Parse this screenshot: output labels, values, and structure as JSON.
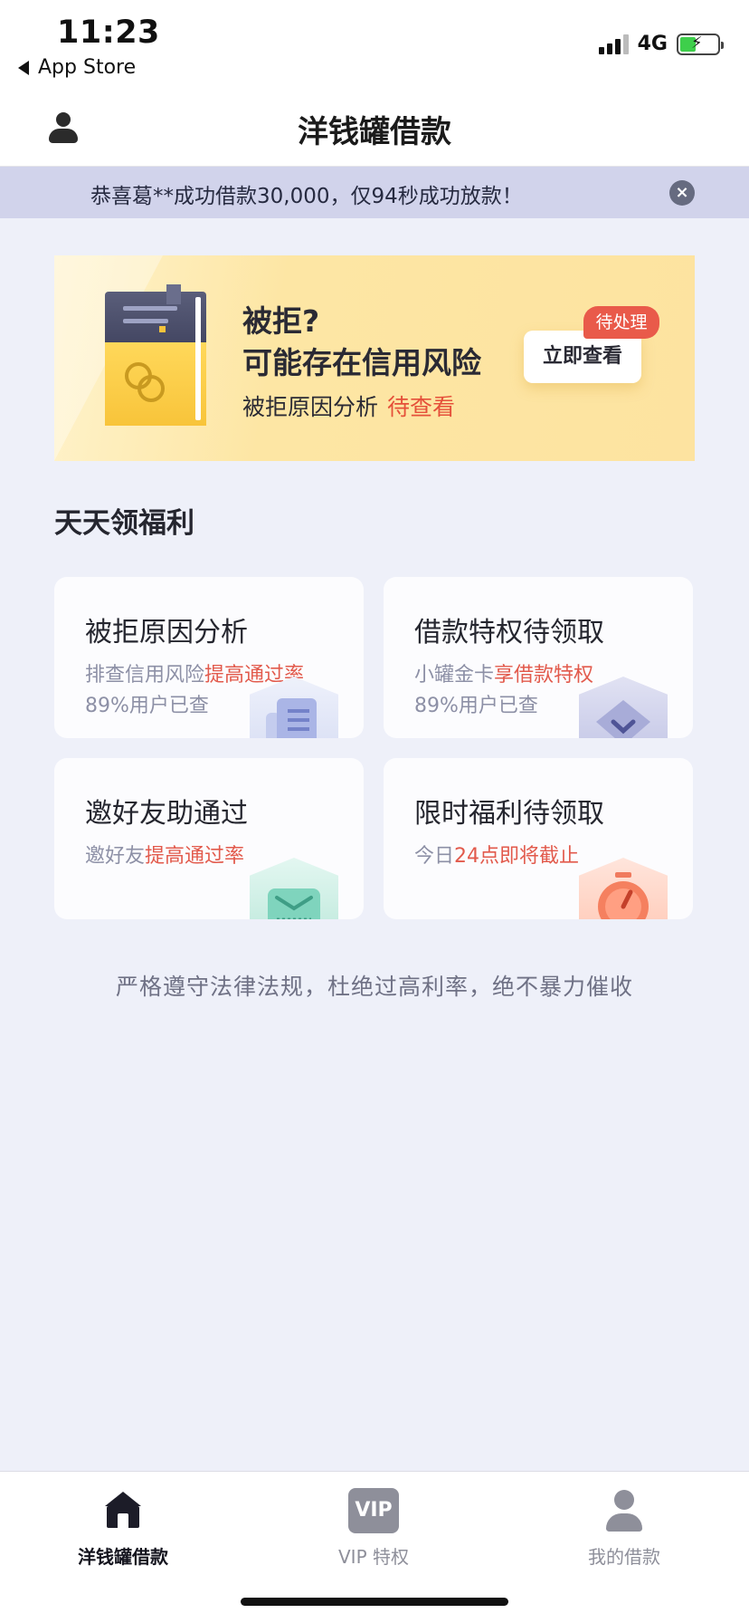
{
  "status_bar": {
    "time": "11:23",
    "back_label": "App Store",
    "network": "4G",
    "battery_level": 0.42,
    "battery_color": "#3ecf4b"
  },
  "nav": {
    "title": "洋钱罐借款",
    "left_icon": "user-icon"
  },
  "notice": {
    "text": "恭喜葛**成功借款30,000，仅94秒成功放款！",
    "close_icon": "close-icon"
  },
  "banner": {
    "title_line1": "被拒?",
    "title_line2": "可能存在信用风险",
    "sub_text": "被拒原因分析",
    "sub_highlight": "待查看",
    "button_label": "立即查看",
    "tag_label": "待处理",
    "icon": "book-icon"
  },
  "section": {
    "title": "天天领福利"
  },
  "cards": [
    {
      "title": "被拒原因分析",
      "sub_plain": "排查信用风险",
      "sub_highlight": "提高通过率",
      "meta": "89%用户已查",
      "icon": "document-icon"
    },
    {
      "title": "借款特权待领取",
      "sub_plain": "小罐金卡",
      "sub_highlight": "享借款特权",
      "meta": "89%用户已查",
      "icon": "gem-icon"
    },
    {
      "title": "邀好友助通过",
      "sub_plain": "邀好友",
      "sub_highlight": "提高通过率",
      "icon": "mail-icon"
    },
    {
      "title": "限时福利待领取",
      "sub_plain": "今日",
      "sub_highlight": "24点即将截止",
      "icon": "stopwatch-icon"
    }
  ],
  "footer_note": "严格遵守法律法规，杜绝过高利率，绝不暴力催收",
  "tabbar": {
    "items": [
      {
        "label": "洋钱罐借款",
        "icon": "home-icon",
        "active": true
      },
      {
        "label": "VIP 特权",
        "icon": "vip-icon",
        "icon_text": "VIP",
        "active": false
      },
      {
        "label": "我的借款",
        "icon": "person-icon",
        "active": false
      }
    ]
  },
  "colors": {
    "accent_red": "#e5503a",
    "notice_bg": "#d1d3eb",
    "page_bg": "#eef0f9",
    "banner_bg": "#fde3a0"
  }
}
